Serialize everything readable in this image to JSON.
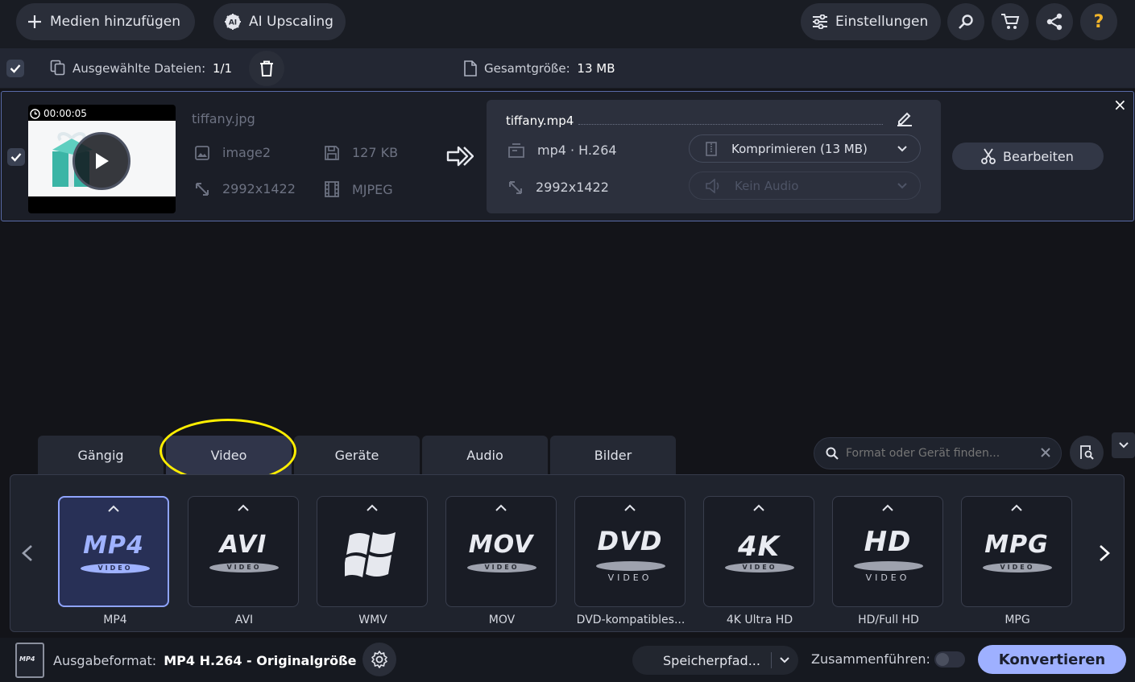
{
  "toolbar": {
    "add_media_label": "Medien hinzufügen",
    "ai_upscaling_label": "AI Upscaling",
    "settings_label": "Einstellungen",
    "help_label": "?"
  },
  "selection": {
    "selected_label": "Ausgewählte Dateien:",
    "selected_count": "1/1",
    "total_size_label": "Gesamtgröße:",
    "total_size_value": "13 MB"
  },
  "file": {
    "duration": "00:00:05",
    "source_name": "tiffany.jpg",
    "source_format": "image2",
    "source_size": "127 KB",
    "source_resolution": "2992x1422",
    "source_codec": "MJPEG",
    "output_name": "tiffany.mp4",
    "output_format": "mp4 · H.264",
    "output_resolution": "2992x1422",
    "compress_label": "Komprimieren (13 MB)",
    "audio_label": "Kein Audio",
    "edit_label": "Bearbeiten",
    "close_symbol": "×"
  },
  "tabs": [
    {
      "label": "Gängig"
    },
    {
      "label": "Video"
    },
    {
      "label": "Geräte"
    },
    {
      "label": "Audio"
    },
    {
      "label": "Bilder"
    }
  ],
  "active_tab": "Video",
  "search": {
    "placeholder": "Format oder Gerät finden..."
  },
  "formats": [
    {
      "logo": "MP4",
      "badge": "VIDEO",
      "label": "MP4",
      "selected": true
    },
    {
      "logo": "AVI",
      "badge": "VIDEO",
      "label": "AVI"
    },
    {
      "logo": "",
      "badge": "",
      "label": "WMV",
      "icon": "windows-logo-icon"
    },
    {
      "logo": "MOV",
      "badge": "VIDEO",
      "label": "MOV"
    },
    {
      "logo": "DVD",
      "badge": "VIDEO",
      "label": "DVD-kompatibles..."
    },
    {
      "logo": "4K",
      "badge": "VIDEO",
      "label": "4K Ultra HD"
    },
    {
      "logo": "HD",
      "badge": "VIDEO",
      "label": "HD/Full HD"
    },
    {
      "logo": "MPG",
      "badge": "VIDEO",
      "label": "MPG"
    }
  ],
  "bottom": {
    "output_format_label": "Ausgabeformat:",
    "output_format_value": "MP4 H.264 - Originalgröße",
    "save_path_label": "Speicherpfad...",
    "merge_label": "Zusammenführen:",
    "convert_label": "Konvertieren",
    "file_icon_text": "MP4"
  },
  "colors": {
    "accent": "#8fa4ff",
    "convert_button": "#9eb0ff",
    "help_icon": "#f3b52a",
    "highlight_circle": "#ffee00"
  }
}
